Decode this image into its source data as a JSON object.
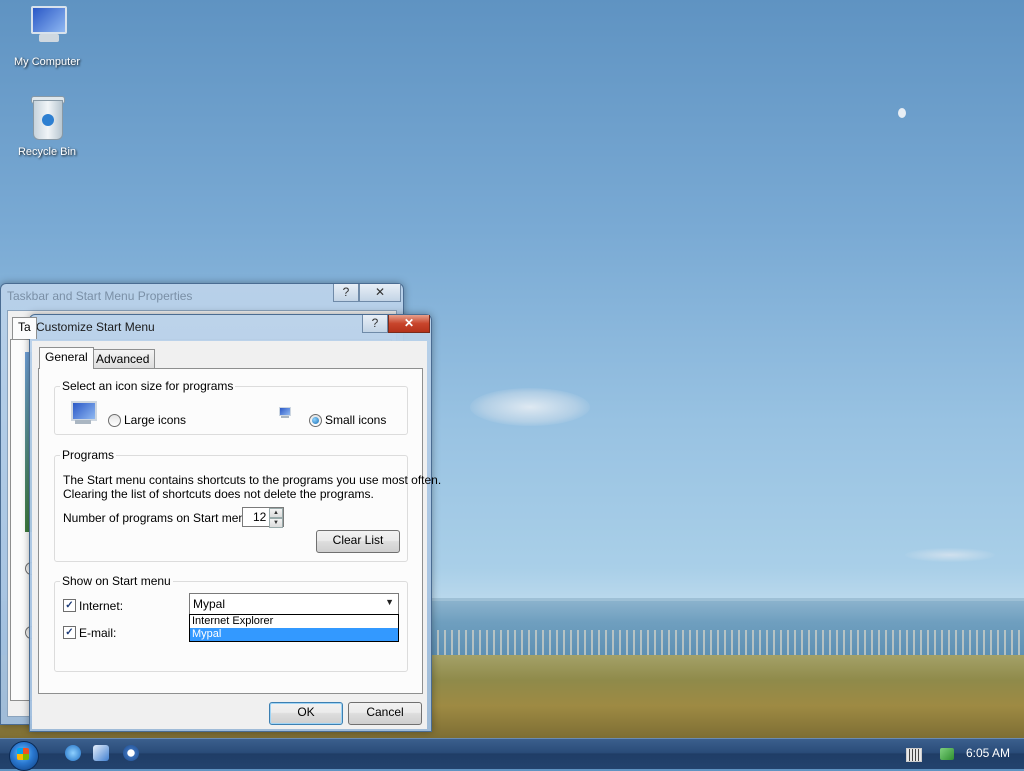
{
  "desktop": {
    "icons": [
      {
        "label": "My Computer",
        "icon": "computer-icon"
      },
      {
        "label": "Recycle Bin",
        "icon": "recycle-bin-icon"
      }
    ]
  },
  "back_window": {
    "title": "Taskbar and Start Menu Properties",
    "tab_partial": "Ta",
    "help_button": "?",
    "close_button": "✕"
  },
  "dialog": {
    "title": "Customize Start Menu",
    "help_button": "?",
    "close_button": "✕",
    "tabs": [
      "General",
      "Advanced"
    ],
    "active_tab": "General",
    "icon_size_group": {
      "legend": "Select an icon size for programs",
      "options": [
        {
          "label": "Large icons",
          "selected": false
        },
        {
          "label": "Small icons",
          "selected": true
        }
      ]
    },
    "programs_group": {
      "legend": "Programs",
      "description_line1": "The Start menu contains shortcuts to the programs you use most often.",
      "description_line2": "Clearing the list of shortcuts does not delete the programs.",
      "count_label": "Number of programs on Start menu:",
      "count_value": "12",
      "clear_button": "Clear List"
    },
    "show_group": {
      "legend": "Show on Start menu",
      "internet": {
        "label": "Internet:",
        "checked": true,
        "value": "Mypal"
      },
      "email": {
        "label": "E-mail:",
        "checked": true
      },
      "dropdown_options": [
        {
          "label": "Internet Explorer",
          "selected": false
        },
        {
          "label": "Mypal",
          "selected": true
        }
      ]
    },
    "ok_button": "OK",
    "cancel_button": "Cancel"
  },
  "taskbar": {
    "clock": "6:05 AM",
    "quick_launch": [
      "internet-explorer-icon",
      "mypal-browser-icon",
      "media-player-icon"
    ],
    "tray": [
      "keyboard-icon",
      "network-icon"
    ]
  },
  "colors": {
    "selection": "#3399ff",
    "taskbar": "#2a4c79"
  }
}
